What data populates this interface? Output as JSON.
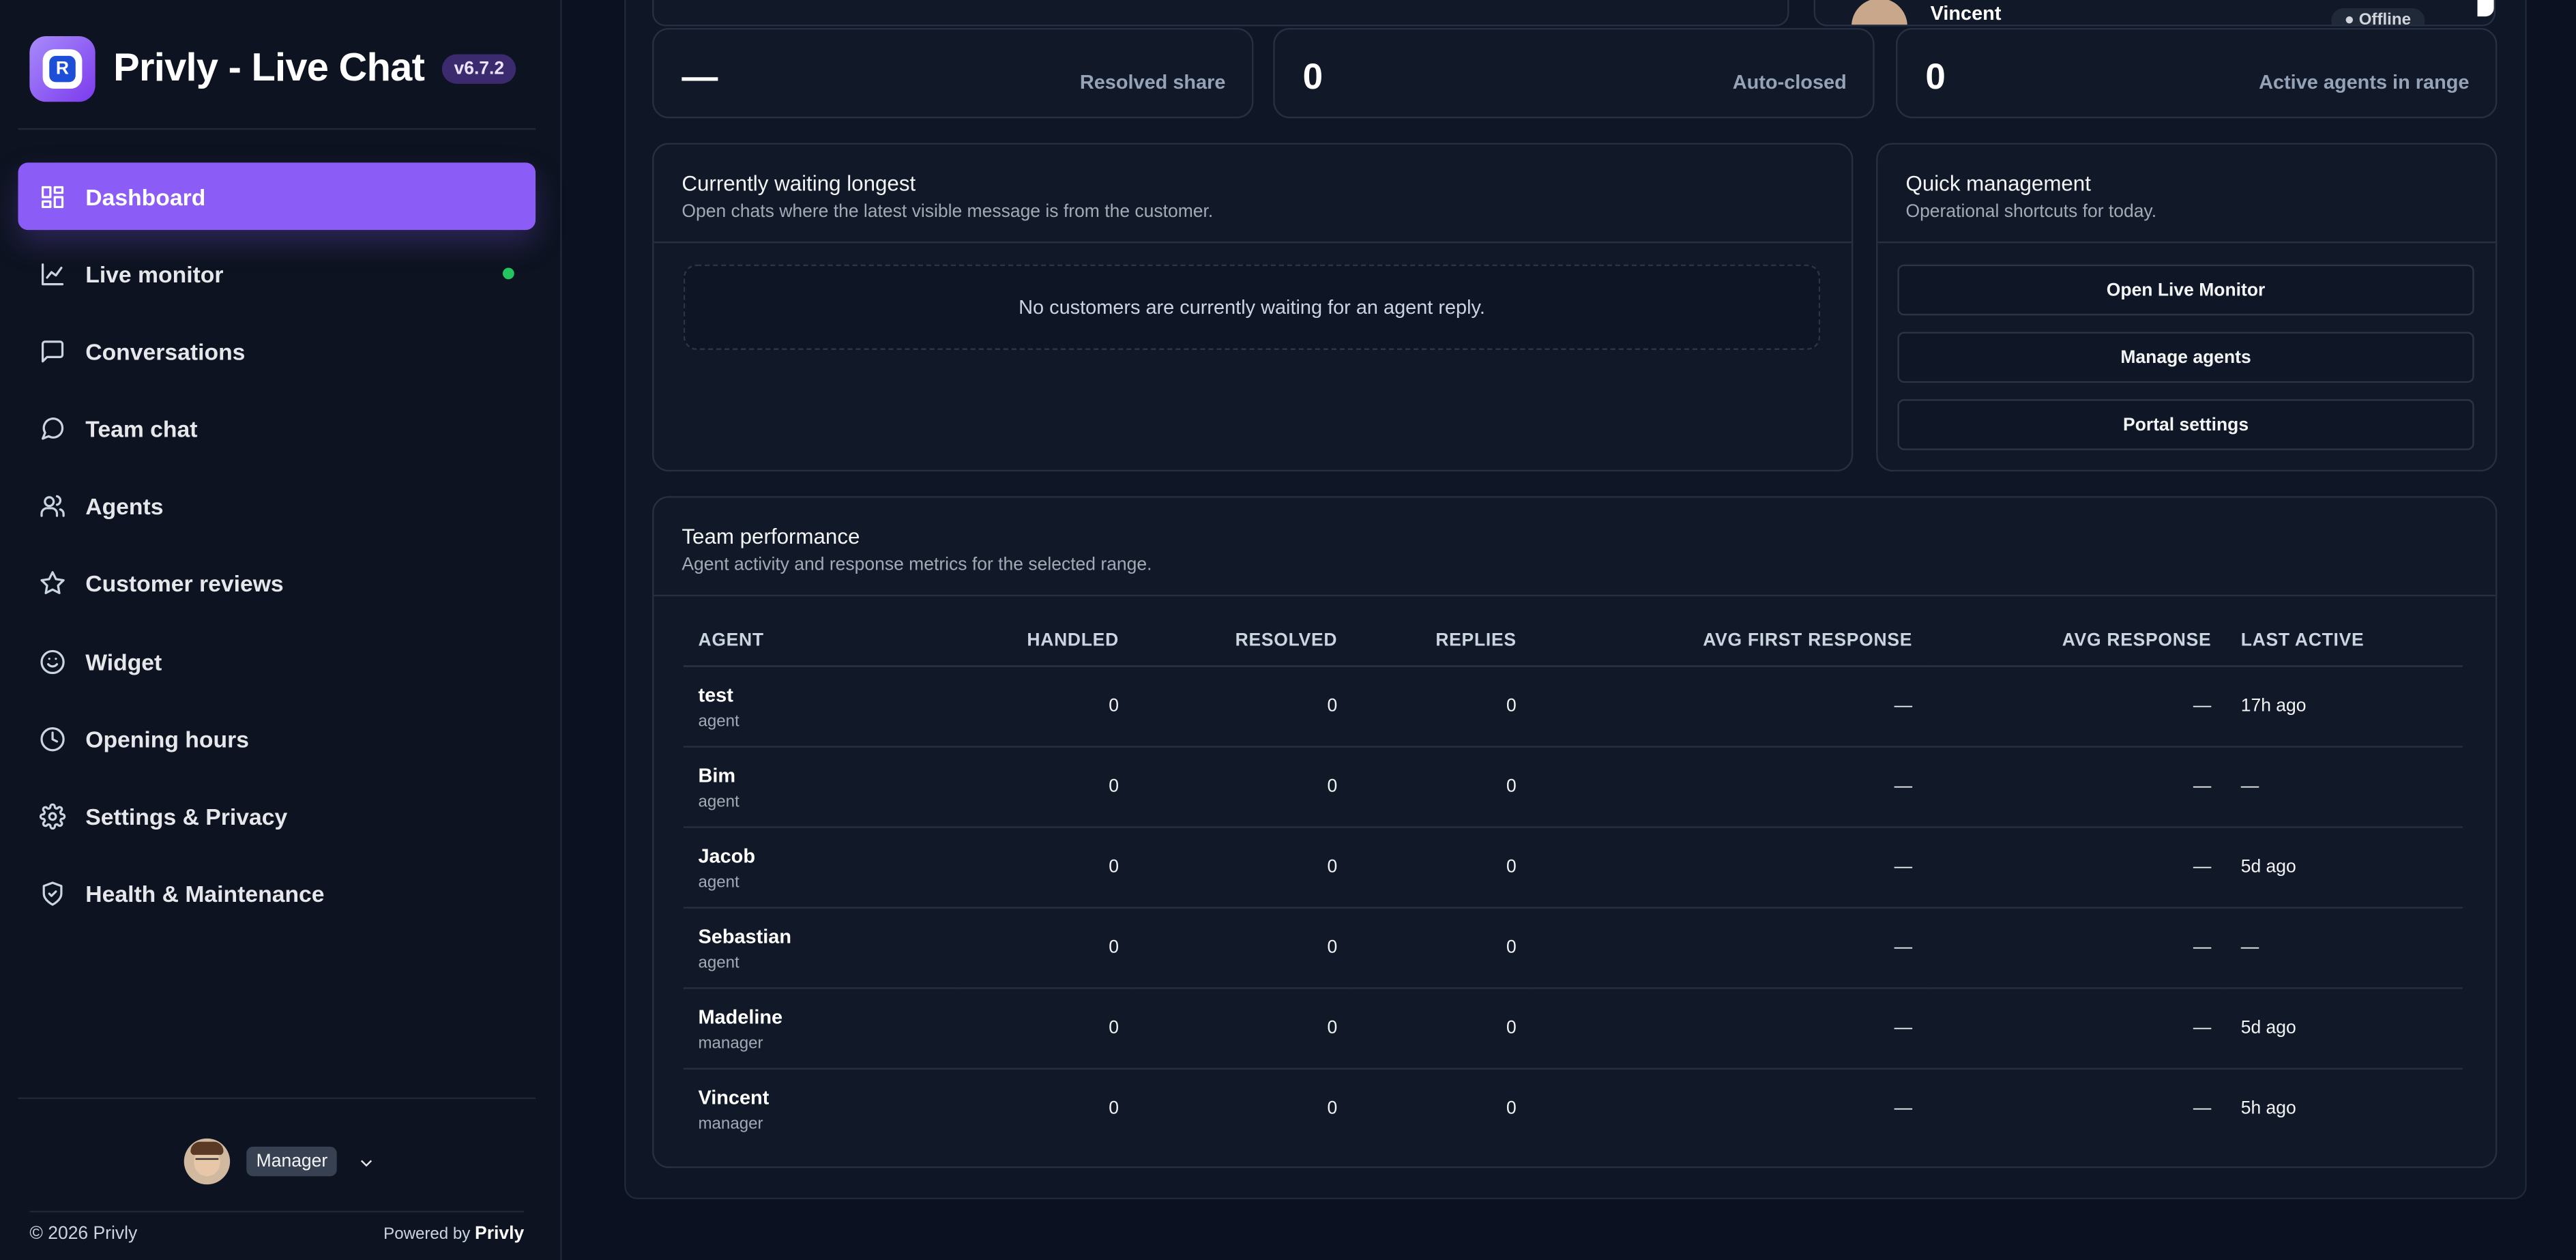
{
  "brand": {
    "title": "Privly - Live Chat",
    "version": "v6.7.2"
  },
  "nav": {
    "items": [
      {
        "label": "Dashboard",
        "icon": "grid-icon",
        "active": true
      },
      {
        "label": "Live monitor",
        "icon": "chart-line-icon",
        "status_dot": "#22c55e"
      },
      {
        "label": "Conversations",
        "icon": "message-square-icon"
      },
      {
        "label": "Team chat",
        "icon": "message-circle-icon"
      },
      {
        "label": "Agents",
        "icon": "users-icon"
      },
      {
        "label": "Customer reviews",
        "icon": "star-icon"
      },
      {
        "label": "Widget",
        "icon": "smile-icon"
      },
      {
        "label": "Opening hours",
        "icon": "clock-icon"
      },
      {
        "label": "Settings & Privacy",
        "icon": "gear-icon"
      },
      {
        "label": "Health & Maintenance",
        "icon": "shield-check-icon"
      }
    ]
  },
  "user": {
    "role": "Manager"
  },
  "footer": {
    "copyright": "© 2026 Privly",
    "powered_prefix": "Powered by",
    "powered_brand": "Privly"
  },
  "top_partial": {
    "agent_name": "Vincent",
    "status": "Offline"
  },
  "stats": [
    {
      "value": "—",
      "label": "Resolved share"
    },
    {
      "value": "0",
      "label": "Auto-closed"
    },
    {
      "value": "0",
      "label": "Active agents in range"
    }
  ],
  "waiting": {
    "title": "Currently waiting longest",
    "subtitle": "Open chats where the latest visible message is from the customer.",
    "empty": "No customers are currently waiting for an agent reply."
  },
  "quick": {
    "title": "Quick management",
    "subtitle": "Operational shortcuts for today.",
    "buttons": [
      "Open Live Monitor",
      "Manage agents",
      "Portal settings"
    ]
  },
  "team": {
    "title": "Team performance",
    "subtitle": "Agent activity and response metrics for the selected range.",
    "columns": [
      "AGENT",
      "HANDLED",
      "RESOLVED",
      "REPLIES",
      "AVG FIRST RESPONSE",
      "AVG RESPONSE",
      "LAST ACTIVE"
    ],
    "rows": [
      {
        "name": "test",
        "role": "agent",
        "handled": "0",
        "resolved": "0",
        "replies": "0",
        "avg_first": "—",
        "avg": "—",
        "last": "17h ago"
      },
      {
        "name": "Bim",
        "role": "agent",
        "handled": "0",
        "resolved": "0",
        "replies": "0",
        "avg_first": "—",
        "avg": "—",
        "last": "—"
      },
      {
        "name": "Jacob",
        "role": "agent",
        "handled": "0",
        "resolved": "0",
        "replies": "0",
        "avg_first": "—",
        "avg": "—",
        "last": "5d ago"
      },
      {
        "name": "Sebastian",
        "role": "agent",
        "handled": "0",
        "resolved": "0",
        "replies": "0",
        "avg_first": "—",
        "avg": "—",
        "last": "—"
      },
      {
        "name": "Madeline",
        "role": "manager",
        "handled": "0",
        "resolved": "0",
        "replies": "0",
        "avg_first": "—",
        "avg": "—",
        "last": "5d ago"
      },
      {
        "name": "Vincent",
        "role": "manager",
        "handled": "0",
        "resolved": "0",
        "replies": "0",
        "avg_first": "—",
        "avg": "—",
        "last": "5h ago"
      }
    ]
  }
}
